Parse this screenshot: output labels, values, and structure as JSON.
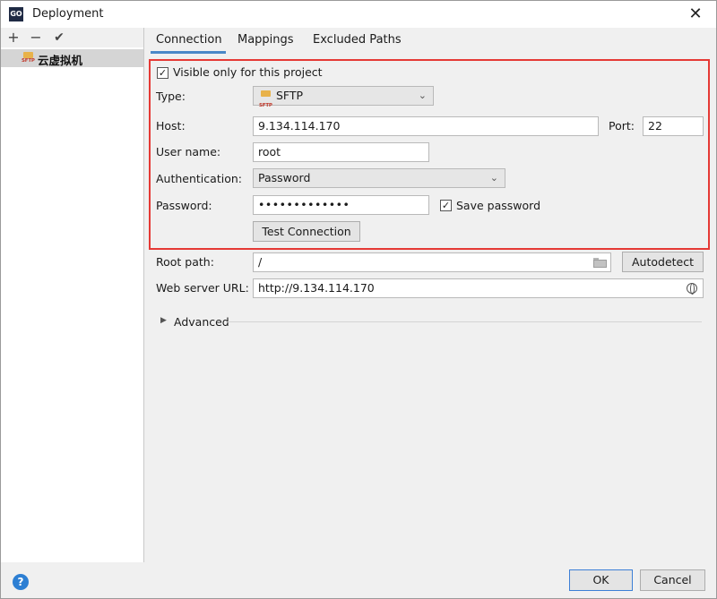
{
  "window": {
    "title": "Deployment",
    "app_icon": "GO"
  },
  "left_panel": {
    "toolbar": {
      "add": "+",
      "remove": "−",
      "check": "✔"
    },
    "server_icon_label": "SFTP",
    "server_name": "云虚拟机"
  },
  "tabs": [
    {
      "label": "Connection",
      "active": true
    },
    {
      "label": "Mappings",
      "active": false
    },
    {
      "label": "Excluded Paths",
      "active": false
    }
  ],
  "connection": {
    "visible_only_label": "Visible only for this project",
    "visible_only_checked": true,
    "type_label": "Type:",
    "type_value": "SFTP",
    "type_icon_label": "SFTP",
    "host_label": "Host:",
    "host_value": "9.134.114.170",
    "port_label": "Port:",
    "port_value": "22",
    "username_label": "User name:",
    "username_value": "root",
    "auth_label": "Authentication:",
    "auth_value": "Password",
    "password_label": "Password:",
    "password_value": "•••••••••••••",
    "save_password_label": "Save password",
    "save_password_checked": true,
    "test_connection_label": "Test Connection",
    "root_path_label": "Root path:",
    "root_path_value": "/",
    "autodetect_label": "Autodetect",
    "web_url_label": "Web server URL:",
    "web_url_value": "http://9.134.114.170",
    "advanced_label": "Advanced"
  },
  "footer": {
    "help": "?",
    "ok_label": "OK",
    "cancel_label": "Cancel"
  },
  "colors": {
    "highlight_border": "#e53935",
    "tab_underline": "#4a88c7",
    "help_icon": "#2d7fd3"
  }
}
